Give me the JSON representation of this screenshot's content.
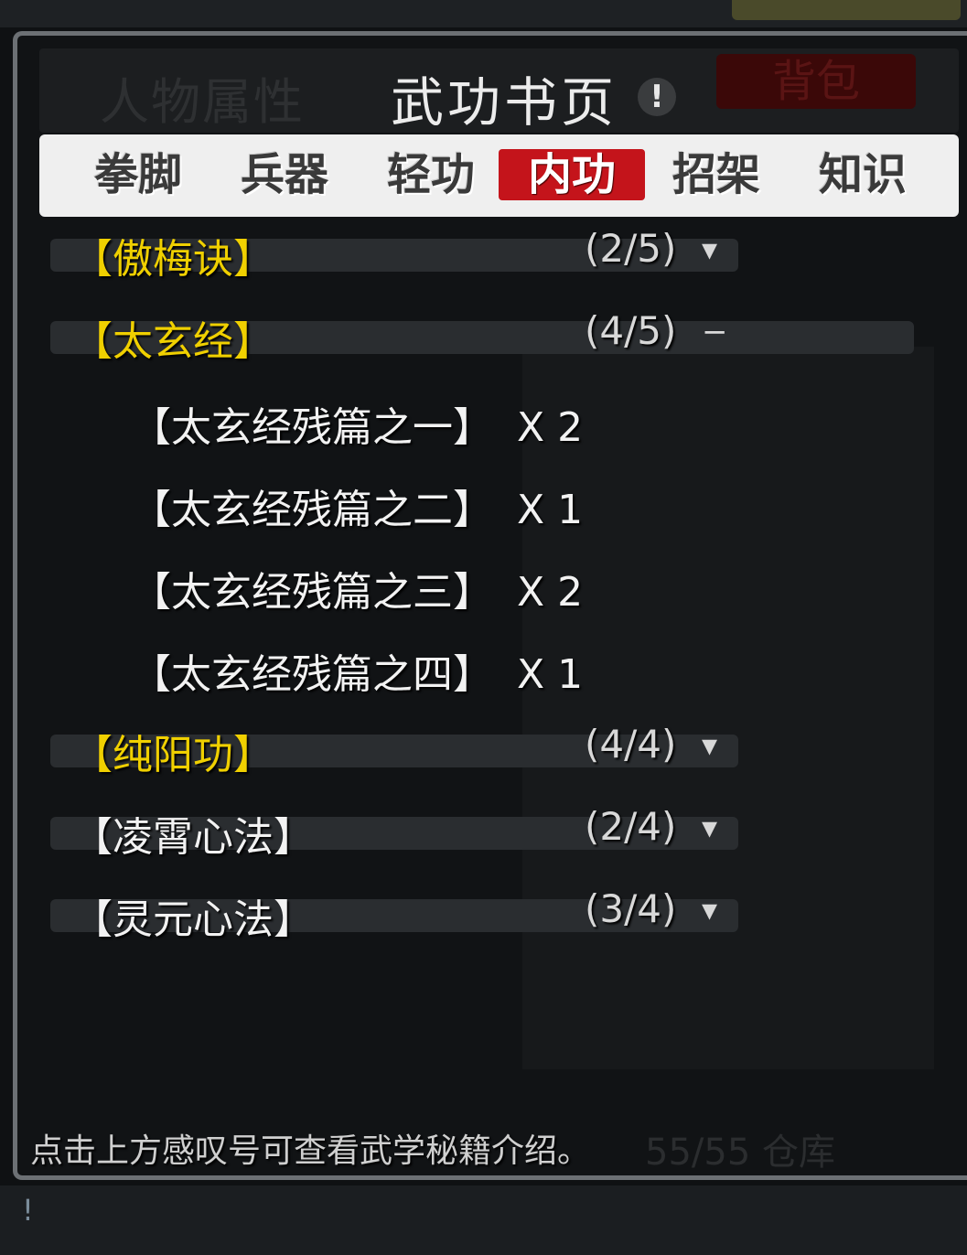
{
  "dialog": {
    "title": "武功书页",
    "info_glyph": "!",
    "left_tab_ghost": "人物属性",
    "right_tab_ghost": "背包"
  },
  "tabs": [
    {
      "label": "拳脚",
      "active": false
    },
    {
      "label": "兵器",
      "active": false
    },
    {
      "label": "轻功",
      "active": false
    },
    {
      "label": "内功",
      "active": true
    },
    {
      "label": "招架",
      "active": false
    },
    {
      "label": "知识",
      "active": false
    }
  ],
  "techniques": [
    {
      "name": "【傲梅诀】",
      "count": "(2/5)",
      "toggle": "▾",
      "color": "gold",
      "expanded": false
    },
    {
      "name": "【太玄经】",
      "count": "(4/5)",
      "toggle": "−",
      "color": "gold",
      "expanded": true
    },
    {
      "name": "【纯阳功】",
      "count": "(4/4)",
      "toggle": "▾",
      "color": "gold",
      "expanded": false
    },
    {
      "name": "【凌霄心法】",
      "count": "(2/4)",
      "toggle": "▾",
      "color": "white",
      "expanded": false
    },
    {
      "name": "【灵元心法】",
      "count": "(3/4)",
      "toggle": "▾",
      "color": "white",
      "expanded": false
    }
  ],
  "expanded_pages": [
    {
      "name": "【太玄经残篇之一】",
      "qty": "X 2"
    },
    {
      "name": "【太玄经残篇之二】",
      "qty": "X 1"
    },
    {
      "name": "【太玄经残篇之三】",
      "qty": "X 2"
    },
    {
      "name": "【太玄经残篇之四】",
      "qty": "X 1"
    }
  ],
  "footer": {
    "tip": "点击上方感叹号可查看武学秘籍介绍。",
    "ghost_storage": "55/55 仓库"
  },
  "bottom_bar": {
    "glyph": "!"
  },
  "colors": {
    "gold_text": "#f0d000",
    "active_tab": "#c4141b",
    "tab_bar": "#efefef"
  }
}
